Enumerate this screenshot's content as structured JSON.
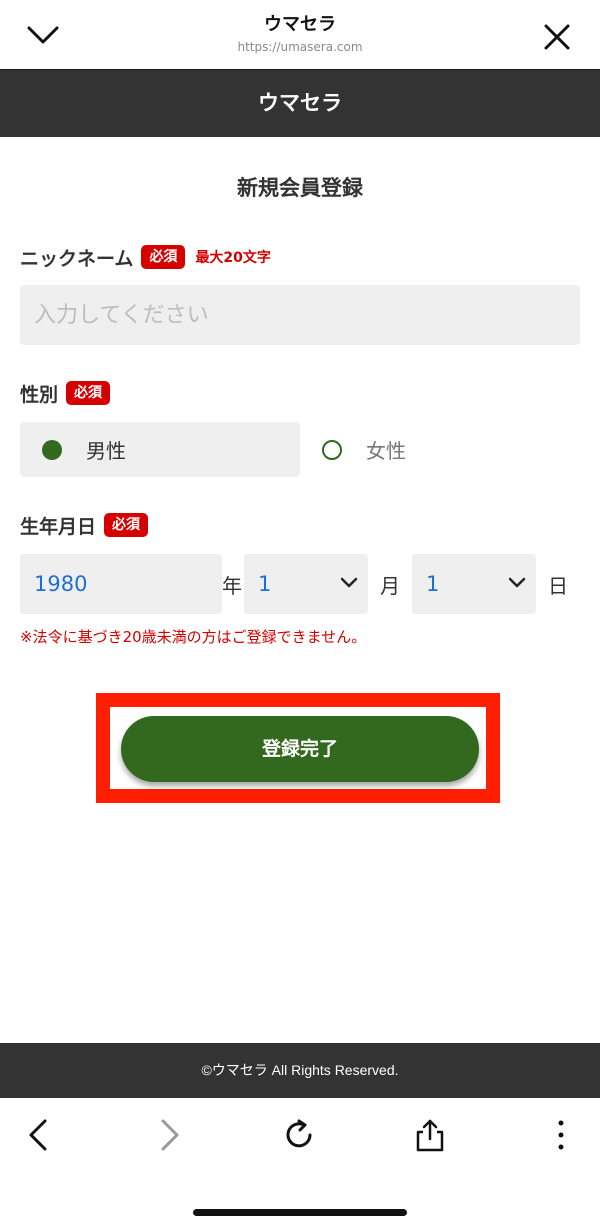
{
  "browser": {
    "title": "ウマセラ",
    "url": "https://umasera.com"
  },
  "header": {
    "logo": "ウマセラ"
  },
  "form": {
    "title": "新規会員登録",
    "nickname": {
      "label": "ニックネーム",
      "required": "必須",
      "max_note": "最大20文字",
      "placeholder": "入力してください"
    },
    "gender": {
      "label": "性別",
      "required": "必須",
      "options": [
        {
          "label": "男性",
          "selected": true
        },
        {
          "label": "女性",
          "selected": false
        }
      ]
    },
    "birthdate": {
      "label": "生年月日",
      "required": "必須",
      "year": "1980",
      "year_unit": "年",
      "month": "1",
      "month_unit": "月",
      "day": "1",
      "day_unit": "日",
      "note": "※法令に基づき20歳未満の方はご登録できません。"
    },
    "submit_label": "登録完了"
  },
  "footer": {
    "copyright": "©ウマセラ All Rights Reserved."
  },
  "colors": {
    "header_bg": "#333333",
    "accent_green": "#33691e",
    "required_red": "#d50000",
    "highlight_red": "#ff1f00",
    "select_text_blue": "#1e6fd9"
  }
}
